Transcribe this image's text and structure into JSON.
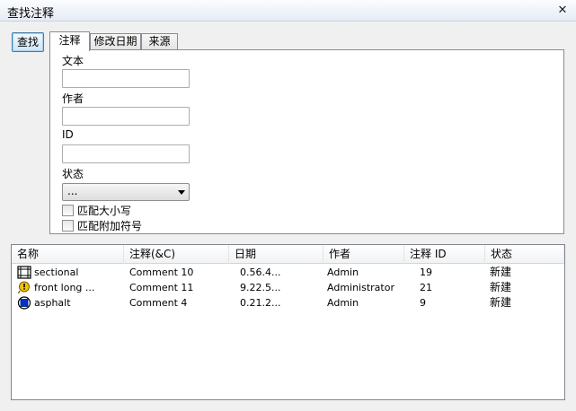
{
  "window": {
    "title": "查找注释",
    "close_symbol": "✕"
  },
  "find_button": "查找",
  "tabs": [
    {
      "label": "注释",
      "active": true
    },
    {
      "label": "修改日期",
      "active": false
    },
    {
      "label": "来源",
      "active": false
    }
  ],
  "form": {
    "text_label": "文本",
    "text_value": "",
    "author_label": "作者",
    "author_value": "",
    "id_label": "ID",
    "id_value": "",
    "status_label": "状态",
    "status_value": "...",
    "match_case_label": "匹配大小写",
    "match_case_checked": false,
    "match_diacritics_label": "匹配附加符号",
    "match_diacritics_checked": false
  },
  "results": {
    "columns": [
      "名称",
      "注释(&C)",
      "日期",
      "作者",
      "注释 ID",
      "状态"
    ],
    "rows": [
      {
        "icon": "film-frame-icon",
        "name": "sectional",
        "comment": "Comment 10",
        "date": "0.56.4...",
        "author": "Admin",
        "id": "19",
        "status": "新建"
      },
      {
        "icon": "warning-pin-icon",
        "name": "front long ...",
        "comment": "Comment 11",
        "date": "9.22.5...",
        "author": "Administrator",
        "id": "21",
        "status": "新建"
      },
      {
        "icon": "blue-square-icon",
        "name": "asphalt",
        "comment": "Comment 4",
        "date": "0.21.2...",
        "author": "Admin",
        "id": "9",
        "status": "新建"
      }
    ]
  },
  "colors": {
    "accent": "#3c7fb1",
    "row_icon_blue": "#0033cc",
    "warning_yellow": "#f5c400"
  }
}
